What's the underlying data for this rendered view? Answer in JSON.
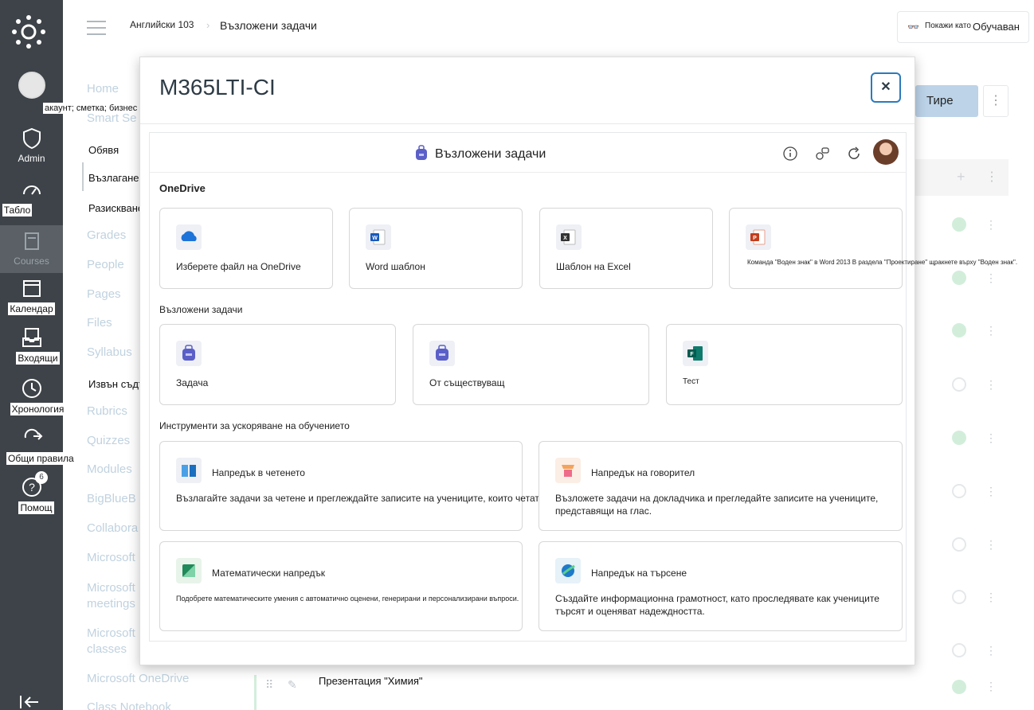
{
  "global_nav": {
    "account_label": "акаунт; сметка; бизнес партньор",
    "admin_label": "Admin",
    "dashboard_label": "Табло",
    "courses_label": "Courses",
    "calendar_label": "Календар",
    "inbox_label": "Входящи",
    "history_label": "Хронология",
    "commons_label": "Общи правила",
    "help_label": "Помощ",
    "help_badge": "6"
  },
  "topbar": {
    "crumb_course": "Английски 103",
    "crumb_page": "Възложени задачи",
    "view_as_prefix": "Покажи като",
    "view_as_role": "Обучаван"
  },
  "course_nav": {
    "items": [
      "Home",
      "Smart Se",
      "Обявя",
      "Възлагане на мен",
      "Разискване",
      "Grades",
      "People",
      "Pages",
      "Files",
      "Syllabus",
      "Извън съдържане",
      "Rubrics",
      "Quizzes",
      "Modules",
      "BigBlueB",
      "Collabora",
      "Microsoft",
      "Microsoft meetings",
      "Microsoft classes",
      "Microsoft OneDrive",
      "Class Notebook"
    ]
  },
  "main": {
    "dashboard_button": "Тире",
    "kebab": "⋮",
    "plus": "+",
    "chem_title": "Презентация \"Химия\""
  },
  "modal": {
    "title": "M365LTI-CI",
    "close_glyph": "✕",
    "app_title": "Възложени задачи",
    "sections": {
      "onedrive": "OneDrive",
      "assignments": "Възложени задачи",
      "accelerators": "Инструменти за ускоряване на обучението"
    },
    "onedrive_cards": [
      {
        "label": "Изберете файл на OneDrive"
      },
      {
        "label": "Word шаблон"
      },
      {
        "label": "Шаблон на Excel"
      },
      {
        "label": "Команда \"Воден знак\" в Word 2013 В раздела \"Проектиране\" щракнете върху \"Воден знак\"."
      }
    ],
    "assignment_cards": [
      {
        "label": "Задача"
      },
      {
        "label": "От съществуващ"
      },
      {
        "label": "Тест"
      }
    ],
    "accelerator_cards": [
      {
        "title": "Напредък в четенето",
        "desc": "Възлагайте задачи за четене и преглеждайте записите на учениците, които четат на глас."
      },
      {
        "title": "Напредък на говорител",
        "desc": "Възложете задачи на докладчика и прегледайте записите на учениците, представящи на глас."
      },
      {
        "title": "Математически напредък",
        "desc": "Подобрете математическите умения с автоматично оценени, генерирани и персонализирани въпроси."
      },
      {
        "title": "Напредък на търсене",
        "desc": "Създайте информационна грамотност, като проследявате как учениците търсят и оценяват надеждността."
      }
    ]
  }
}
